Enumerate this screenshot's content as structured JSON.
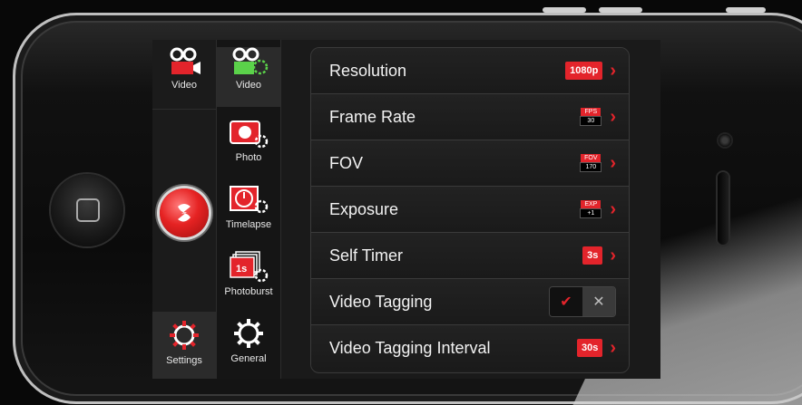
{
  "nav_primary": {
    "video_label": "Video",
    "settings_label": "Settings"
  },
  "nav_secondary": {
    "items": [
      {
        "label": "Video"
      },
      {
        "label": "Photo"
      },
      {
        "label": "Timelapse"
      },
      {
        "label": "Photoburst"
      },
      {
        "label": "General"
      }
    ],
    "photoburst_icon_text": "1s"
  },
  "settings": {
    "rows": [
      {
        "label": "Resolution",
        "value": "1080p"
      },
      {
        "label": "Frame Rate",
        "value_top": "FPS",
        "value_bottom": "30"
      },
      {
        "label": "FOV",
        "value_top": "FOV",
        "value_bottom": "170"
      },
      {
        "label": "Exposure",
        "value_top": "EXP",
        "value_bottom": "+1"
      },
      {
        "label": "Self Timer",
        "value": "3s"
      },
      {
        "label": "Video Tagging",
        "toggle_on": "✔",
        "toggle_off": "✕"
      },
      {
        "label": "Video Tagging Interval",
        "value": "30s"
      }
    ]
  },
  "icons": {
    "chevron": "›"
  },
  "colors": {
    "accent": "#e3242b",
    "active_icon": "#5bd24a"
  }
}
